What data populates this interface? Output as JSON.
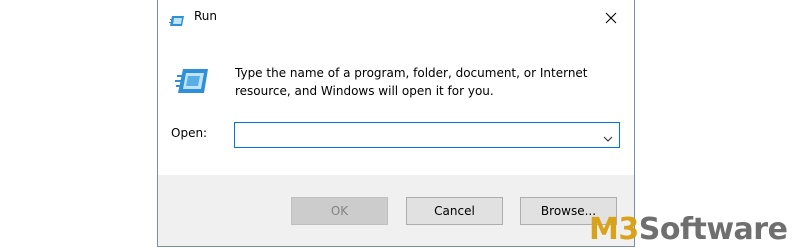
{
  "window": {
    "title": "Run",
    "close_icon": "close-icon"
  },
  "message": {
    "icon": "run-icon",
    "line1": "Type the name of a program, folder, document, or Internet",
    "line2": "resource, and Windows will open it for you."
  },
  "open_field": {
    "label": "Open:",
    "value": "",
    "dropdown_icon": "chevron-down-icon"
  },
  "buttons": {
    "ok": "OK",
    "cancel": "Cancel",
    "browse": "Browse..."
  },
  "watermark": {
    "brand_m3": "M3",
    "brand_software": "Software"
  },
  "colors": {
    "accent": "#0078d7",
    "footer_bg": "#f0f0f0",
    "brand_gold": "#d9a21b",
    "brand_gray": "#6f6f6f"
  }
}
